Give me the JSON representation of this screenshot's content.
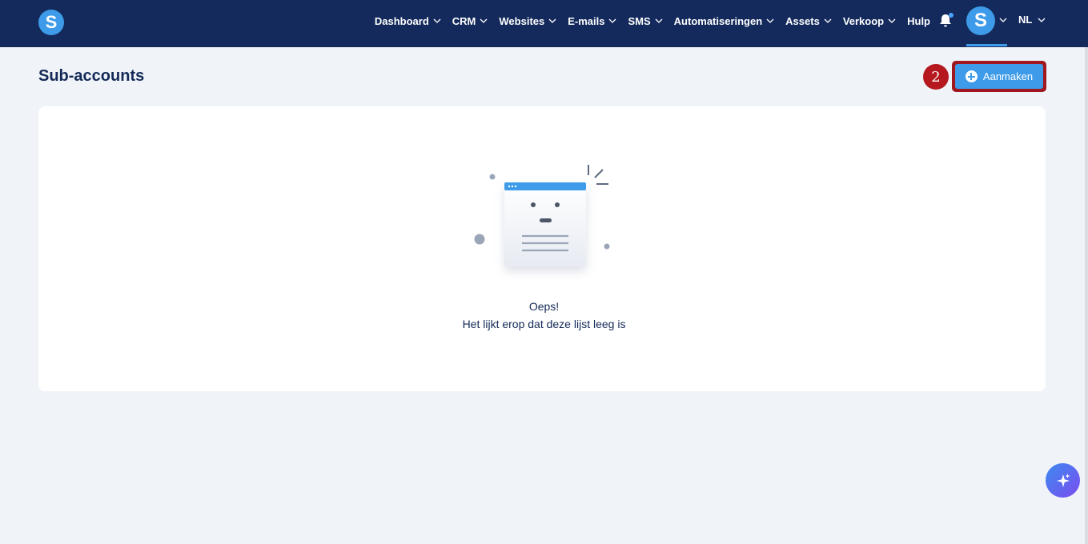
{
  "app": {
    "logo_letter": "S"
  },
  "nav": {
    "items": [
      {
        "label": "Dashboard",
        "has_dropdown": true
      },
      {
        "label": "CRM",
        "has_dropdown": true
      },
      {
        "label": "Websites",
        "has_dropdown": true
      },
      {
        "label": "E-mails",
        "has_dropdown": true
      },
      {
        "label": "SMS",
        "has_dropdown": true
      },
      {
        "label": "Automatiseringen",
        "has_dropdown": true
      },
      {
        "label": "Assets",
        "has_dropdown": true
      },
      {
        "label": "Verkoop",
        "has_dropdown": true
      },
      {
        "label": "Hulp",
        "has_dropdown": false
      }
    ],
    "notification_icon": "bell-icon",
    "avatar_letter": "S",
    "language": "NL"
  },
  "page": {
    "title": "Sub-accounts",
    "step_badge": "2",
    "create_button_label": "Aanmaken",
    "create_button_icon": "plus-circle-icon"
  },
  "empty_state": {
    "title": "Oeps!",
    "message": "Het lijkt erop dat deze lijst leeg is",
    "illustration": "empty-list-illustration"
  },
  "fab": {
    "icon": "sparkle-icon"
  },
  "colors": {
    "topbar": "#142a5c",
    "accent": "#3d9be9",
    "highlight": "#a0171d",
    "background": "#f0f3f8"
  }
}
